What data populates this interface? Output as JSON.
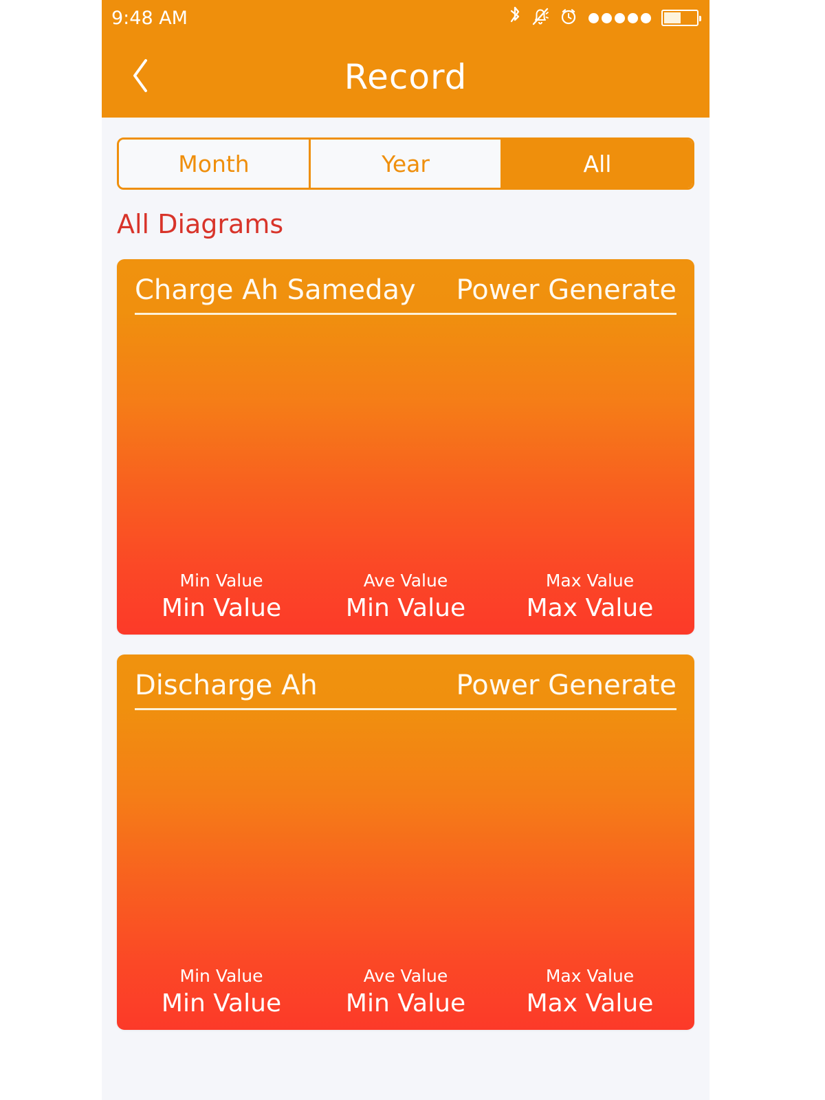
{
  "status_bar": {
    "time": "9:48 AM",
    "icons": [
      {
        "name": "bluetooth-icon",
        "glyph": "bluetooth"
      },
      {
        "name": "bell-muted-icon",
        "glyph": "bell-slash"
      },
      {
        "name": "alarm-clock-icon",
        "glyph": "alarm"
      }
    ],
    "signal_dots": 5,
    "battery_level_percent": 47
  },
  "nav": {
    "back_icon": "chevron-left-icon",
    "title": "Record"
  },
  "segmented_control": {
    "options": [
      {
        "label": "Month",
        "selected": false
      },
      {
        "label": "Year",
        "selected": false
      },
      {
        "label": "All",
        "selected": true
      }
    ],
    "selected": "All",
    "accent_color": "#ef8f0c"
  },
  "section": {
    "title": "All Diagrams",
    "title_color": "#d8342a"
  },
  "cards": [
    {
      "title": "Charge Ah Sameday",
      "subtitle": "Power Generate",
      "stats": [
        {
          "label": "Min Value",
          "value": "Min Value"
        },
        {
          "label": "Ave Value",
          "value": "Min Value"
        },
        {
          "label": "Max Value",
          "value": "Max Value"
        }
      ],
      "gradient_top": "#f0920e",
      "gradient_bottom": "#fc3a29"
    },
    {
      "title": "Discharge Ah",
      "subtitle": "Power Generate",
      "stats": [
        {
          "label": "Min Value",
          "value": "Min Value"
        },
        {
          "label": "Ave Value",
          "value": "Min Value"
        },
        {
          "label": "Max Value",
          "value": "Max Value"
        }
      ],
      "gradient_top": "#f0920e",
      "gradient_bottom": "#fc3a29"
    }
  ],
  "theme": {
    "header_orange": "#ef8f0c",
    "page_background": "#f5f6fa",
    "text_on_orange": "#ffffff"
  }
}
